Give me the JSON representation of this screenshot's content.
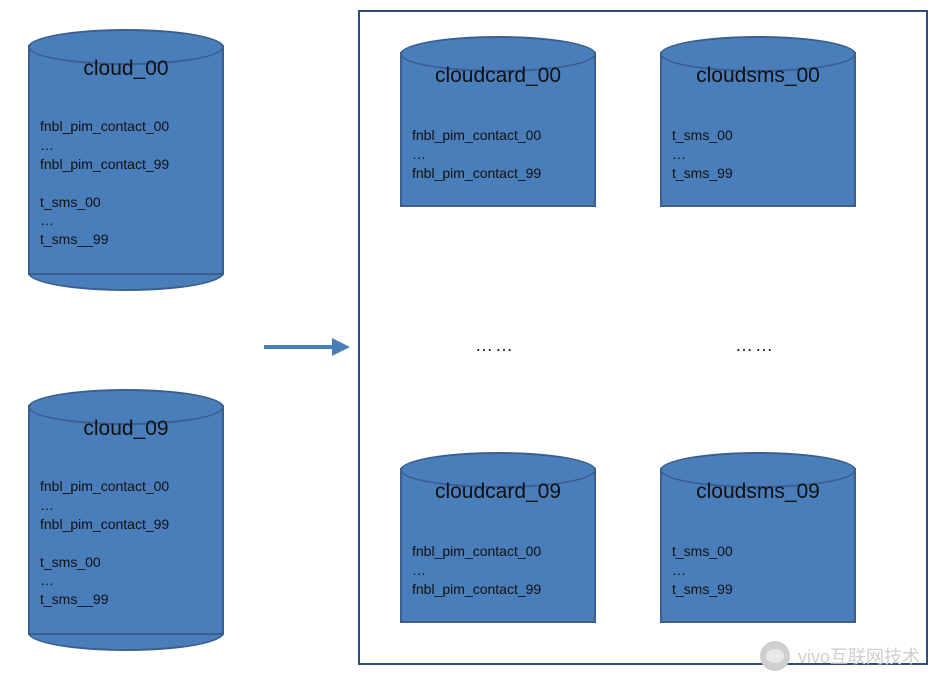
{
  "colors": {
    "cylinder_fill": "#4a7ebb",
    "cylinder_stroke": "#3a5f8f",
    "box_stroke": "#2d4e7a",
    "arrow_stroke": "#4a7ebb"
  },
  "left_dbs": [
    {
      "title": "cloud_00",
      "tables": "fnbl_pim_contact_00\n…\nfnbl_pim_contact_99\n\nt_sms_00\n…\nt_sms__99"
    },
    {
      "title": "cloud_09",
      "tables": "fnbl_pim_contact_00\n…\nfnbl_pim_contact_99\n\nt_sms_00\n…\nt_sms__99"
    }
  ],
  "right_box": {
    "columns": [
      {
        "top": {
          "title": "cloudcard_00",
          "tables": "fnbl_pim_contact_00\n…\nfnbl_pim_contact_99"
        },
        "ellipsis": "……",
        "bottom": {
          "title": "cloudcard_09",
          "tables": "fnbl_pim_contact_00\n…\nfnbl_pim_contact_99"
        }
      },
      {
        "top": {
          "title": "cloudsms_00",
          "tables": "t_sms_00\n…\nt_sms_99"
        },
        "ellipsis": "……",
        "bottom": {
          "title": "cloudsms_09",
          "tables": "t_sms_00\n…\nt_sms_99"
        }
      }
    ]
  },
  "arrow_label": "",
  "watermark": "vivo互联网技术"
}
